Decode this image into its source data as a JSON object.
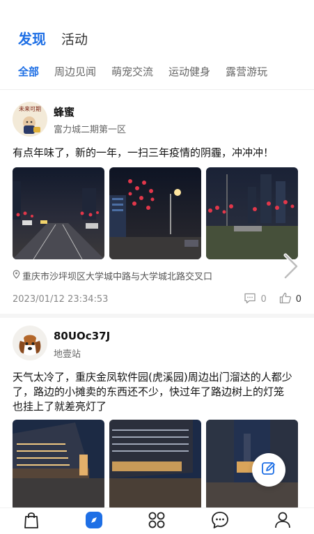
{
  "header": {
    "tabs": [
      {
        "label": "发现",
        "active": true
      },
      {
        "label": "活动",
        "active": false
      }
    ]
  },
  "categories": [
    "全部",
    "周边见闻",
    "萌宠交流",
    "运动健身",
    "露营游玩"
  ],
  "active_category": "全部",
  "accent_color": "#1e6fe5",
  "posts": [
    {
      "username": "蜂蜜",
      "location_name": "富力城二期第一区",
      "avatar_caption": "未来可期",
      "text": "有点年味了，新的一年，一扫三年疫情的阴霾，冲冲冲！",
      "address": "重庆市沙坪坝区大学城中路与大学城北路交叉口",
      "timestamp": "2023/01/12 23:34:53",
      "comments": "0",
      "likes": "0"
    },
    {
      "username": "80UOc37J",
      "location_name": "地壹站",
      "text": "天气太冷了，重庆金凤软件园(虎溪园)周边出门溜达的人都少了，路边的小摊卖的东西还不少，快过年了路边树上的灯笼　也挂上了就差亮灯了"
    }
  ],
  "bottom_nav": {
    "items": [
      "shopping-bag-icon",
      "compass-icon",
      "grid-icon",
      "message-icon",
      "profile-icon"
    ],
    "active": "compass-icon"
  }
}
